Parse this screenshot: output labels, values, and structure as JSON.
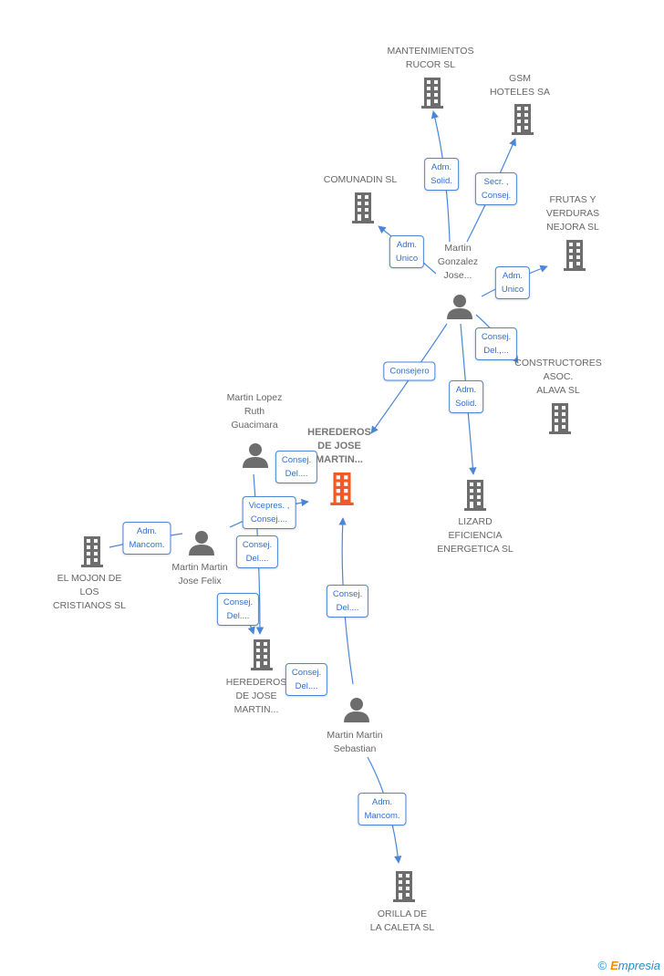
{
  "colors": {
    "company": "#6d6d6d",
    "main_company": "#f05a28",
    "edge": "#4a86d8",
    "person": "#6d6d6d"
  },
  "nodes": {
    "mantenimientos": "MANTENIMIENTOS\nRUCOR SL",
    "gsm": "GSM\nHOTELES SA",
    "comunadin": "COMUNADIN SL",
    "frutas": "FRUTAS Y\nVERDURAS\nNEJORA  SL",
    "martin_gonzalez": "Martin\nGonzalez\nJose...",
    "constructores": "CONSTRUCTORES\nASOC.\nALAVA SL",
    "lizard": "LIZARD\nEFICIENCIA\nENERGETICA  SL",
    "herederos_main": "HEREDEROS\nDE JOSE\nMARTIN...",
    "martin_lopez": "Martin Lopez\nRuth\nGuacimara",
    "martin_jose_felix": "Martin Martin\nJose Felix",
    "mojon": "EL MOJON DE\nLOS\nCRISTIANOS SL",
    "herederos_2": "HEREDEROS\nDE JOSE\nMARTIN...",
    "martin_sebastian": "Martin Martin\nSebastian",
    "orilla": "ORILLA DE\nLA CALETA SL"
  },
  "relations": [
    "Adm.\nSolid.",
    "Secr. ,\nConsej.",
    "Adm.\nUnico",
    "Adm.\nUnico",
    "Consej.\nDel.,...",
    "Consejero",
    "Adm.\nSolid.",
    "Consej.\nDel....",
    "Vicepres. ,\nConsej....",
    "Adm.\nMancom.",
    "Consej.\nDel....",
    "Consej.\nDel....",
    "Consej.\nDel....",
    "Consej.\nDel....",
    "Adm.\nMancom."
  ],
  "logo": {
    "copyright": "©",
    "text": "mpresia",
    "initial": "E"
  }
}
